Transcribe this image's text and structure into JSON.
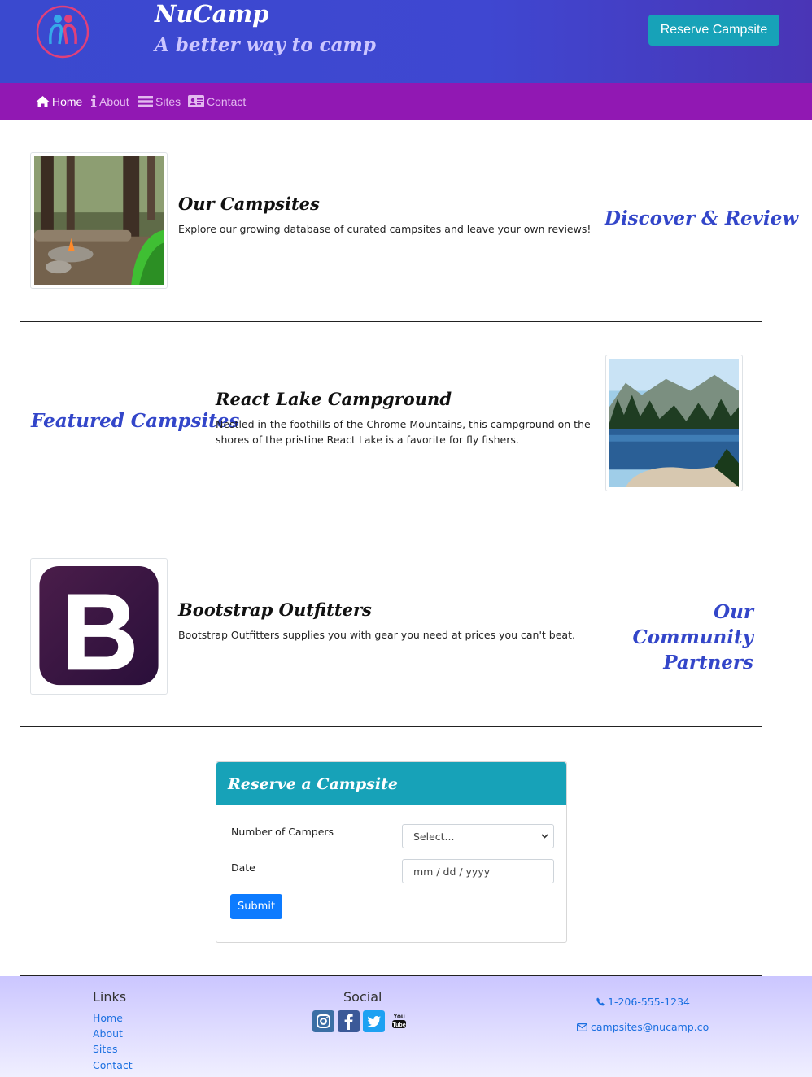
{
  "header": {
    "brand": "NuCamp",
    "tagline": "A better way to camp",
    "reserve_button": "Reserve Campsite"
  },
  "nav": {
    "items": [
      {
        "label": "Home",
        "icon": "home-icon",
        "active": true
      },
      {
        "label": "About",
        "icon": "info-icon",
        "active": false
      },
      {
        "label": "Sites",
        "icon": "list-icon",
        "active": false
      },
      {
        "label": "Contact",
        "icon": "address-card-icon",
        "active": false
      }
    ]
  },
  "rows": [
    {
      "title": "Our Campsites",
      "text": "Explore our growing database of curated campsites and leave your own reviews!",
      "side_heading": "Discover & Review"
    },
    {
      "title": "React Lake Campground",
      "text_line1": "Nestled in the foothills of the Chrome Mountains, this campground on the",
      "text_line2": "shores of the pristine React Lake is a favorite for fly fishers.",
      "side_heading": "Featured Campsites"
    },
    {
      "title": "Bootstrap Outfitters",
      "text": "Bootstrap Outfitters supplies you with gear you need at prices you can't beat.",
      "side_heading_line1": "Our Community",
      "side_heading_line2": "Partners"
    }
  ],
  "reserve_form": {
    "title": "Reserve a Campsite",
    "campers_label": "Number of Campers",
    "campers_value": "Select...",
    "date_label": "Date",
    "date_placeholder": "mm / dd / yyyy",
    "submit_label": "Submit"
  },
  "footer": {
    "links_heading": "Links",
    "links": [
      "Home",
      "About",
      "Sites",
      "Contact"
    ],
    "social_heading": "Social",
    "social_icons": [
      "instagram-icon",
      "facebook-icon",
      "twitter-icon",
      "youtube-icon"
    ],
    "phone": "1-206-555-1234",
    "email": "campsites@nucamp.co"
  },
  "colors": {
    "header_bg": "#3f47d1",
    "navbar_bg": "#9118b3",
    "accent_teal": "#17a2b8",
    "heading_blue": "#3346c9",
    "link_blue": "#1a6fe0",
    "submit_blue": "#0d7bff"
  }
}
